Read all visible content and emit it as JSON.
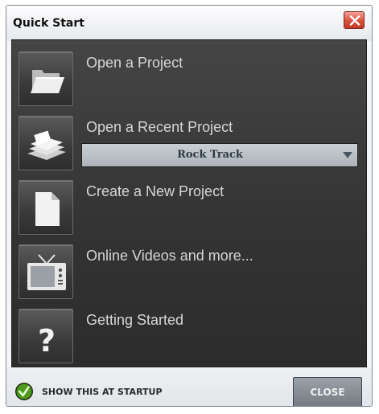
{
  "window": {
    "title": "Quick Start",
    "close_icon": "close-x-icon"
  },
  "items": [
    {
      "label": "Open a Project",
      "icon": "open-folder-icon"
    },
    {
      "label": "Open a Recent Project",
      "icon": "recent-project-icon"
    },
    {
      "label": "Create a New Project",
      "icon": "new-document-icon"
    },
    {
      "label": "Online Videos and more...",
      "icon": "tv-icon"
    },
    {
      "label": "Getting Started",
      "icon": "question-mark-icon"
    }
  ],
  "recent_project": {
    "selected": "Rock Track",
    "icon": "chevron-down-icon"
  },
  "footer": {
    "show_at_startup_label": "SHOW THIS AT STARTUP",
    "show_at_startup_checked": true,
    "close_label": "CLOSE",
    "check_icon": "checkmark-icon"
  },
  "question_glyph": "?",
  "colors": {
    "panel": "#333333",
    "label_text": "#d6d6d6",
    "check_green": "#4d9a1e",
    "close_x_red": "#d9503c"
  }
}
